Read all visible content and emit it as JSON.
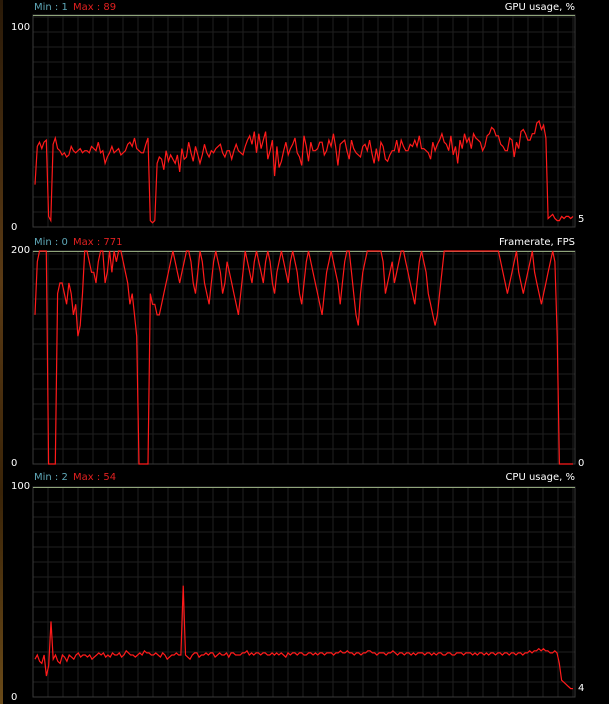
{
  "colors": {
    "line": "#ff1a1a",
    "max_line": "#8fa57a",
    "grid": "#1f1f1f",
    "frame": "#3a3a3a",
    "min_label": "#5fa8b8",
    "max_label": "#e02020"
  },
  "panels": [
    {
      "title": "GPU usage, %",
      "min_label": "Min : 1",
      "max_label": "Max : 89",
      "y_top_label": "100",
      "y_bottom_label": "0",
      "current": "5"
    },
    {
      "title": "Framerate, FPS",
      "min_label": "Min : 0",
      "max_label": "Max : 771",
      "y_top_label": "200",
      "y_bottom_label": "0",
      "current": "0"
    },
    {
      "title": "CPU usage, %",
      "min_label": "Min : 2",
      "max_label": "Max : 54",
      "y_top_label": "100",
      "y_bottom_label": "0",
      "current": "4"
    }
  ],
  "chart_data": [
    {
      "type": "line",
      "title": "GPU usage, %",
      "ylim": [
        0,
        100
      ],
      "grid": true,
      "series": [
        {
          "values": [
            20,
            38,
            40,
            37,
            40,
            41,
            5,
            3,
            39,
            42,
            37,
            36,
            34,
            35,
            33,
            34,
            38,
            36,
            35,
            36,
            37,
            35,
            36,
            36,
            35,
            38,
            37,
            36,
            40,
            35,
            36,
            30,
            33,
            35,
            38,
            35,
            36,
            37,
            34,
            35,
            36,
            39,
            40,
            38,
            42,
            37,
            36,
            35,
            35,
            39,
            42,
            3,
            2,
            3,
            30,
            33,
            32,
            27,
            36,
            31,
            34,
            32,
            30,
            34,
            26,
            37,
            32,
            33,
            40,
            35,
            31,
            38,
            34,
            30,
            34,
            39,
            35,
            33,
            36,
            35,
            37,
            38,
            39,
            35,
            33,
            36,
            36,
            32,
            36,
            39,
            36,
            35,
            34,
            38,
            41,
            43,
            39,
            45,
            35,
            44,
            37,
            41,
            45,
            32,
            36,
            41,
            24,
            38,
            28,
            31,
            36,
            40,
            34,
            37,
            39,
            42,
            35,
            33,
            29,
            43,
            38,
            31,
            40,
            36,
            36,
            37,
            40,
            40,
            34,
            36,
            41,
            38,
            44,
            38,
            29,
            39,
            40,
            41,
            36,
            32,
            41,
            37,
            35,
            34,
            33,
            38,
            39,
            36,
            41,
            35,
            30,
            37,
            31,
            40,
            38,
            32,
            31,
            34,
            36,
            36,
            41,
            35,
            41,
            38,
            36,
            36,
            39,
            38,
            41,
            38,
            43,
            37,
            37,
            36,
            35,
            32,
            40,
            36,
            39,
            41,
            44,
            40,
            39,
            36,
            43,
            34,
            38,
            30,
            41,
            37,
            44,
            40,
            42,
            37,
            44,
            42,
            41,
            40,
            36,
            38,
            43,
            44,
            47,
            46,
            43,
            43,
            39,
            38,
            36,
            36,
            42,
            41,
            33,
            40,
            37,
            45,
            46,
            44,
            41,
            41,
            44,
            44,
            49,
            50,
            46,
            48,
            42,
            4,
            5,
            6,
            4,
            3,
            3,
            5,
            4,
            5,
            5,
            4,
            5
          ]
        }
      ]
    },
    {
      "type": "line",
      "title": "Framerate, FPS",
      "ylim": [
        0,
        200
      ],
      "grid": true,
      "series": [
        {
          "values": [
            140,
            190,
            200,
            200,
            200,
            200,
            0,
            0,
            0,
            0,
            160,
            170,
            170,
            160,
            150,
            170,
            160,
            140,
            150,
            120,
            130,
            160,
            200,
            200,
            190,
            180,
            180,
            170,
            190,
            200,
            200,
            170,
            180,
            200,
            180,
            200,
            190,
            200,
            200,
            190,
            180,
            170,
            150,
            160,
            140,
            120,
            0,
            0,
            0,
            0,
            0,
            160,
            150,
            150,
            140,
            140,
            150,
            160,
            170,
            180,
            190,
            200,
            190,
            180,
            170,
            180,
            190,
            200,
            200,
            190,
            170,
            160,
            180,
            200,
            190,
            170,
            160,
            150,
            170,
            190,
            200,
            190,
            180,
            160,
            170,
            190,
            180,
            170,
            160,
            150,
            140,
            160,
            180,
            200,
            190,
            180,
            170,
            190,
            200,
            190,
            180,
            170,
            190,
            200,
            190,
            170,
            160,
            180,
            190,
            200,
            190,
            180,
            170,
            190,
            200,
            190,
            180,
            160,
            150,
            170,
            190,
            200,
            190,
            180,
            170,
            160,
            150,
            140,
            160,
            180,
            190,
            200,
            190,
            180,
            170,
            150,
            170,
            190,
            200,
            200,
            180,
            160,
            140,
            130,
            160,
            180,
            190,
            200,
            200,
            200,
            200,
            200,
            200,
            200,
            190,
            160,
            170,
            180,
            190,
            170,
            180,
            190,
            200,
            200,
            190,
            180,
            170,
            160,
            150,
            170,
            190,
            200,
            190,
            180,
            160,
            150,
            140,
            130,
            140,
            160,
            180,
            200,
            200,
            200,
            200,
            200,
            200,
            200,
            200,
            200,
            200,
            200,
            200,
            200,
            200,
            200,
            200,
            200,
            200,
            200,
            200,
            200,
            200,
            200,
            200,
            200,
            190,
            180,
            170,
            160,
            170,
            180,
            190,
            200,
            180,
            170,
            160,
            170,
            180,
            190,
            200,
            180,
            170,
            160,
            150,
            160,
            170,
            180,
            190,
            200,
            190,
            120,
            0,
            0,
            0,
            0,
            0,
            0,
            0
          ]
        }
      ]
    },
    {
      "type": "line",
      "title": "CPU usage, %",
      "ylim": [
        0,
        100
      ],
      "grid": true,
      "series": [
        {
          "values": [
            18,
            20,
            17,
            16,
            20,
            10,
            15,
            36,
            18,
            20,
            17,
            16,
            20,
            19,
            17,
            20,
            19,
            18,
            20,
            21,
            19,
            20,
            20,
            19,
            20,
            18,
            19,
            20,
            21,
            20,
            21,
            19,
            20,
            19,
            21,
            20,
            20,
            21,
            19,
            20,
            22,
            21,
            20,
            20,
            19,
            20,
            21,
            20,
            22,
            21,
            21,
            20,
            20,
            21,
            20,
            19,
            21,
            20,
            18,
            19,
            20,
            20,
            21,
            20,
            20,
            53,
            20,
            19,
            18,
            20,
            21,
            21,
            19,
            20,
            20,
            21,
            20,
            21,
            21,
            19,
            20,
            21,
            20,
            20,
            21,
            19,
            21,
            21,
            20,
            20,
            20,
            21,
            21,
            22,
            20,
            21,
            20,
            21,
            21,
            20,
            21,
            21,
            20,
            20,
            21,
            20,
            21,
            20,
            21,
            20,
            19,
            21,
            20,
            21,
            21,
            20,
            21,
            21,
            20,
            20,
            21,
            21,
            20,
            21,
            20,
            21,
            21,
            20,
            21,
            21,
            21,
            20,
            21,
            21,
            22,
            21,
            21,
            22,
            21,
            21,
            20,
            21,
            21,
            20,
            21,
            21,
            22,
            22,
            21,
            21,
            20,
            21,
            21,
            21,
            20,
            21,
            21,
            22,
            21,
            20,
            21,
            21,
            20,
            21,
            21,
            20,
            21,
            20,
            21,
            21,
            21,
            20,
            21,
            21,
            20,
            21,
            20,
            21,
            21,
            20,
            20,
            21,
            21,
            20,
            20,
            21,
            21,
            21,
            20,
            21,
            21,
            21,
            20,
            21,
            20,
            21,
            21,
            20,
            21,
            20,
            21,
            21,
            20,
            21,
            21,
            20,
            21,
            21,
            20,
            21,
            21,
            20,
            21,
            21,
            20,
            21,
            21,
            22,
            21,
            22,
            22,
            23,
            22,
            23,
            22,
            22,
            21,
            21,
            22,
            21,
            16,
            8,
            7,
            6,
            5,
            4,
            4
          ]
        }
      ]
    }
  ]
}
